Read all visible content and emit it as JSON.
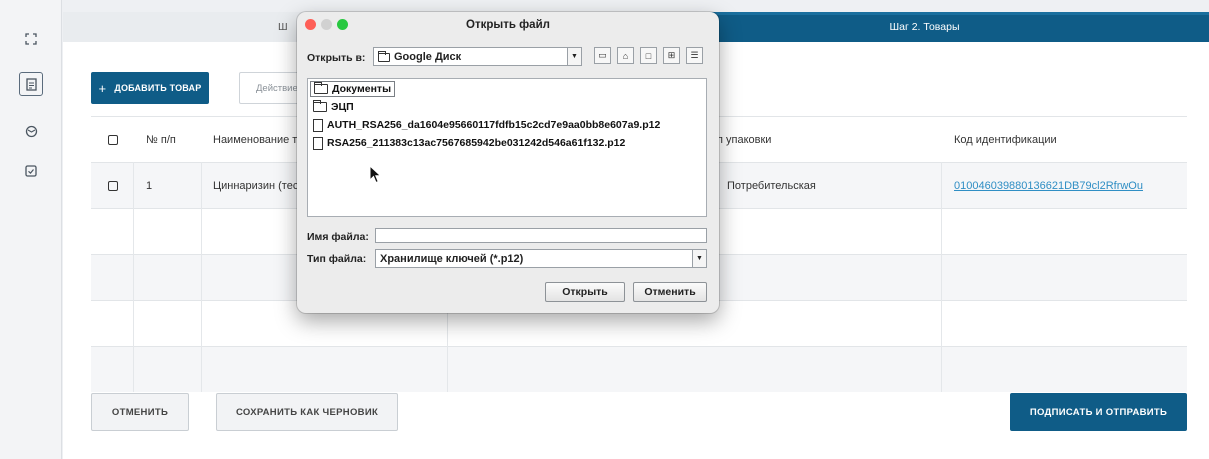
{
  "sidebar": {
    "icons": [
      "expand-icon",
      "document-icon",
      "box-icon",
      "checklist-icon"
    ]
  },
  "steps": {
    "step2_label": "Шаг 2. Товары",
    "step1_label": "Ш"
  },
  "toolbar": {
    "add_label": "ДОБАВИТЬ ТОВАР",
    "add_plus": "+",
    "action_placeholder": "Действие"
  },
  "table": {
    "headers": {
      "num": "№ п/п",
      "name": "Наименование т",
      "pack": "п упаковки",
      "code": "Код идентификации"
    },
    "rows": [
      {
        "num": "1",
        "name": "Циннаризин (тес",
        "pack": "Потребительская",
        "code": "010046039880136621DB79cl2RfrwOu"
      }
    ]
  },
  "footer": {
    "cancel": "ОТМЕНИТЬ",
    "draft": "СОХРАНИТЬ КАК ЧЕРНОВИК",
    "sign": "ПОДПИСАТЬ И ОТПРАВИТЬ"
  },
  "dialog": {
    "title": "Открыть файл",
    "open_in_label": "Открыть в:",
    "location": "Google Диск",
    "files": [
      {
        "name": "Документы",
        "type": "folder"
      },
      {
        "name": "ЭЦП",
        "type": "folder"
      },
      {
        "name": "AUTH_RSA256_da1604e95660117fdfb15c2cd7e9aa0bb8e607a9.p12",
        "type": "file"
      },
      {
        "name": "RSA256_211383c13ac7567685942be031242d546a61f132.p12",
        "type": "file"
      }
    ],
    "filename_label": "Имя файла:",
    "filename_value": "",
    "filetype_label": "Тип файла:",
    "filetype_value": "Хранилище ключей (*.p12)",
    "open_button": "Открыть",
    "cancel_button": "Отменить"
  }
}
